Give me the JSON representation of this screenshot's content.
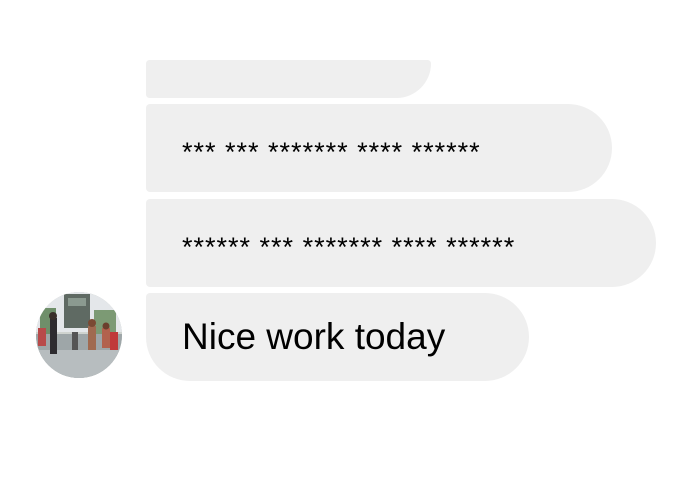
{
  "thread": {
    "messages": [
      {
        "text": ""
      },
      {
        "text": "*** *** ******* **** ******"
      },
      {
        "text": "****** *** ******* **** ******"
      },
      {
        "text": "Nice work today"
      }
    ]
  },
  "colors": {
    "bubble_background": "#efefef",
    "text": "#000000",
    "page_background": "#ffffff"
  },
  "icons": {
    "avatar": "sender-avatar-photo"
  }
}
